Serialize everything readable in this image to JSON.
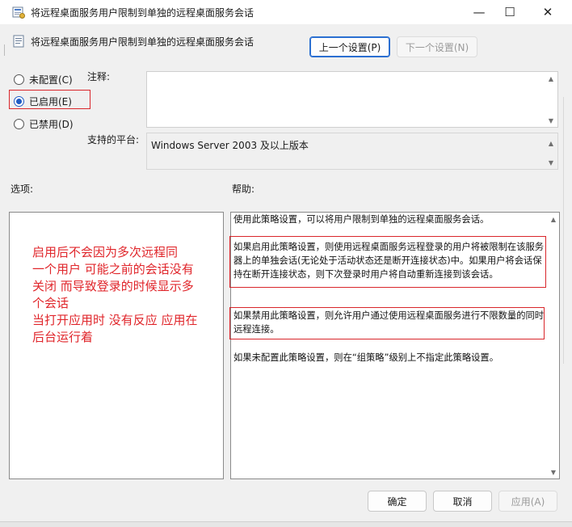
{
  "window": {
    "title": "将远程桌面服务用户限制到单独的远程桌面服务会话",
    "controls": {
      "minimize": "—",
      "maximize": "☐",
      "close": "✕"
    }
  },
  "header": {
    "policy_name": "将远程桌面服务用户限制到单独的远程桌面服务会话",
    "prev_button": "上一个设置(P)",
    "next_button": "下一个设置(N)"
  },
  "state": {
    "options": [
      {
        "label": "未配置(C)",
        "checked": false
      },
      {
        "label": "已启用(E)",
        "checked": true
      },
      {
        "label": "已禁用(D)",
        "checked": false
      }
    ]
  },
  "comment": {
    "label": "注释:",
    "value": ""
  },
  "platform": {
    "label": "支持的平台:",
    "value": "Windows Server 2003 及以上版本"
  },
  "options_section": {
    "label": "选项:"
  },
  "help_section": {
    "label": "帮助:",
    "paragraphs": [
      "使用此策略设置，可以将用户限制到单独的远程桌面服务会话。",
      "如果启用此策略设置，则使用远程桌面服务远程登录的用户将被限制在该服务器上的单独会话(无论处于活动状态还是断开连接状态)中。如果用户将会话保持在断开连接状态，则下次登录时用户将自动重新连接到该会话。",
      "如果禁用此策略设置，则允许用户通过使用远程桌面服务进行不限数量的同时远程连接。",
      "如果未配置此策略设置，则在“组策略”级别上不指定此策略设置。"
    ]
  },
  "annotation": {
    "lines": [
      "启用后不会因为多次远程同",
      "一个用户 可能之前的会话没有",
      "关闭 而导致登录的时候显示多",
      "个会话",
      "当打开应用时 没有反应 应用在",
      "后台运行着"
    ]
  },
  "footer": {
    "ok_button": "确定",
    "cancel_button": "取消",
    "apply_button": "应用(A)"
  },
  "colors": {
    "accent": "#1f5bc4",
    "annotation_red": "#e0262b"
  }
}
